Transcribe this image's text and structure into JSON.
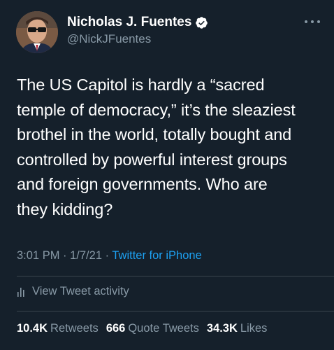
{
  "author": {
    "display_name": "Nicholas J. Fuentes",
    "handle": "@NickJFuentes",
    "verified": true,
    "avatar": "profile-photo"
  },
  "more_menu": {
    "icon": "more-horizontal-icon"
  },
  "tweet": {
    "text": "The US Capitol is hardly a “sacred\ntemple of democracy,” it’s the sleaziest\nbrothel in the world, totally bought and\ncontrolled by powerful interest groups\nand foreign governments. Who are\nthey kidding?",
    "time": "3:01 PM",
    "separator1": " · ",
    "date": "1/7/21",
    "separator2": " · ",
    "source": "Twitter for iPhone"
  },
  "activity": {
    "icon": "analytics-bars-icon",
    "label": "View Tweet activity"
  },
  "stats": {
    "retweets_count": "10.4K",
    "retweets_label": "Retweets",
    "quote_count": "666",
    "quote_label": "Quote Tweets",
    "likes_count": "34.3K",
    "likes_label": "Likes"
  },
  "colors": {
    "background": "#15202b",
    "secondary_text": "#8899a6",
    "link": "#1da1f2",
    "divider": "#38444d"
  }
}
